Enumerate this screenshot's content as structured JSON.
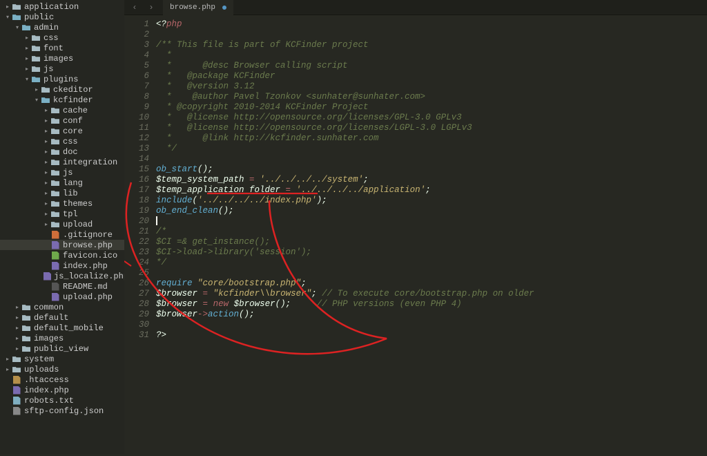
{
  "tab": {
    "name": "browse.php"
  },
  "nav": {
    "back": "‹",
    "forward": "›"
  },
  "tree": [
    {
      "indent": 0,
      "type": "folder-closed",
      "label": "application",
      "tri": "▸"
    },
    {
      "indent": 0,
      "type": "folder-open",
      "label": "public",
      "tri": "▾"
    },
    {
      "indent": 1,
      "type": "folder-open",
      "label": "admin",
      "tri": "▾"
    },
    {
      "indent": 2,
      "type": "folder-closed",
      "label": "css",
      "tri": "▸"
    },
    {
      "indent": 2,
      "type": "folder-closed",
      "label": "font",
      "tri": "▸"
    },
    {
      "indent": 2,
      "type": "folder-closed",
      "label": "images",
      "tri": "▸"
    },
    {
      "indent": 2,
      "type": "folder-closed",
      "label": "js",
      "tri": "▸"
    },
    {
      "indent": 2,
      "type": "folder-open",
      "label": "plugins",
      "tri": "▾"
    },
    {
      "indent": 3,
      "type": "folder-closed",
      "label": "ckeditor",
      "tri": "▸"
    },
    {
      "indent": 3,
      "type": "folder-open",
      "label": "kcfinder",
      "tri": "▾"
    },
    {
      "indent": 4,
      "type": "folder-closed",
      "label": "cache",
      "tri": "▸"
    },
    {
      "indent": 4,
      "type": "folder-closed",
      "label": "conf",
      "tri": "▸"
    },
    {
      "indent": 4,
      "type": "folder-closed",
      "label": "core",
      "tri": "▸"
    },
    {
      "indent": 4,
      "type": "folder-closed",
      "label": "css",
      "tri": "▸"
    },
    {
      "indent": 4,
      "type": "folder-closed",
      "label": "doc",
      "tri": "▸"
    },
    {
      "indent": 4,
      "type": "folder-closed",
      "label": "integration",
      "tri": "▸"
    },
    {
      "indent": 4,
      "type": "folder-closed",
      "label": "js",
      "tri": "▸"
    },
    {
      "indent": 4,
      "type": "folder-closed",
      "label": "lang",
      "tri": "▸"
    },
    {
      "indent": 4,
      "type": "folder-closed",
      "label": "lib",
      "tri": "▸"
    },
    {
      "indent": 4,
      "type": "folder-closed",
      "label": "themes",
      "tri": "▸"
    },
    {
      "indent": 4,
      "type": "folder-closed",
      "label": "tpl",
      "tri": "▸"
    },
    {
      "indent": 4,
      "type": "folder-closed",
      "label": "upload",
      "tri": "▸"
    },
    {
      "indent": 4,
      "type": "file-git",
      "label": ".gitignore"
    },
    {
      "indent": 4,
      "type": "file-php",
      "label": "browse.php",
      "selected": true
    },
    {
      "indent": 4,
      "type": "file-img",
      "label": "favicon.ico"
    },
    {
      "indent": 4,
      "type": "file-php",
      "label": "index.php"
    },
    {
      "indent": 4,
      "type": "file-php",
      "label": "js_localize.php"
    },
    {
      "indent": 4,
      "type": "file-md",
      "label": "README.md"
    },
    {
      "indent": 4,
      "type": "file-php",
      "label": "upload.php"
    },
    {
      "indent": 1,
      "type": "folder-closed",
      "label": "common",
      "tri": "▸"
    },
    {
      "indent": 1,
      "type": "folder-closed",
      "label": "default",
      "tri": "▸"
    },
    {
      "indent": 1,
      "type": "folder-closed",
      "label": "default_mobile",
      "tri": "▸"
    },
    {
      "indent": 1,
      "type": "folder-closed",
      "label": "images",
      "tri": "▸"
    },
    {
      "indent": 1,
      "type": "folder-closed",
      "label": "public_view",
      "tri": "▸"
    },
    {
      "indent": 0,
      "type": "folder-closed",
      "label": "system",
      "tri": "▸"
    },
    {
      "indent": 0,
      "type": "folder-closed",
      "label": "uploads",
      "tri": "▸"
    },
    {
      "indent": 0,
      "type": "file-cfg",
      "label": ".htaccess"
    },
    {
      "indent": 0,
      "type": "file-php",
      "label": "index.php"
    },
    {
      "indent": 0,
      "type": "file-txt",
      "label": "robots.txt"
    },
    {
      "indent": 0,
      "type": "file-json",
      "label": "sftp-config.json"
    }
  ],
  "code": {
    "lines": [
      {
        "n": 1,
        "html": "<span class='c-pun'>&lt;?</span><span class='c-kw'>php</span>"
      },
      {
        "n": 2,
        "html": ""
      },
      {
        "n": 3,
        "html": "<span class='c-com'>/** This file is part of KCFinder project</span>"
      },
      {
        "n": 4,
        "html": "<span class='c-com'>  *</span>"
      },
      {
        "n": 5,
        "html": "<span class='c-com'>  *      @desc Browser calling script</span>"
      },
      {
        "n": 6,
        "html": "<span class='c-com'>  *   @package KCFinder</span>"
      },
      {
        "n": 7,
        "html": "<span class='c-com'>  *   @version 3.12</span>"
      },
      {
        "n": 8,
        "html": "<span class='c-com'>  *    @author Pavel Tzonkov &lt;sunhater@sunhater.com&gt;</span>"
      },
      {
        "n": 9,
        "html": "<span class='c-com'>  * @copyright 2010-2014 KCFinder Project</span>"
      },
      {
        "n": 10,
        "html": "<span class='c-com'>  *   @license http://opensource.org/licenses/GPL-3.0 GPLv3</span>"
      },
      {
        "n": 11,
        "html": "<span class='c-com'>  *   @license http://opensource.org/licenses/LGPL-3.0 LGPLv3</span>"
      },
      {
        "n": 12,
        "html": "<span class='c-com'>  *      @link http://kcfinder.sunhater.com</span>"
      },
      {
        "n": 13,
        "html": "<span class='c-com'>  */</span>"
      },
      {
        "n": 14,
        "html": ""
      },
      {
        "n": 15,
        "html": "<span class='c-fn'>ob_start</span><span class='c-pun'>();</span>"
      },
      {
        "n": 16,
        "html": "<span class='c-var'>$temp_system_path</span> <span class='c-kw'>=</span> <span class='c-str'>'../../../../system'</span><span class='c-pun'>;</span>"
      },
      {
        "n": 17,
        "html": "<span class='c-var'>$temp_application_folder</span> <span class='c-kw'>=</span> <span class='c-str'>'../../../../application'</span><span class='c-pun'>;</span>"
      },
      {
        "n": 18,
        "html": "<span class='c-kw2'>include</span><span class='c-pun'>(</span><span class='c-str'>'../../../../index.php'</span><span class='c-pun'>);</span>"
      },
      {
        "n": 19,
        "html": "<span class='c-fn'>ob_end_clean</span><span class='c-pun'>();</span>"
      },
      {
        "n": 20,
        "html": "<span class='cursor'></span>"
      },
      {
        "n": 21,
        "html": "<span class='c-com'>/*</span>"
      },
      {
        "n": 22,
        "html": "<span class='c-com'>$CI =&amp; get_instance();</span>"
      },
      {
        "n": 23,
        "html": "<span class='c-com'>$CI-&gt;load-&gt;library('session');</span>"
      },
      {
        "n": 24,
        "html": "<span class='c-com'>*/</span>"
      },
      {
        "n": 25,
        "html": ""
      },
      {
        "n": 26,
        "html": "<span class='c-kw2'>require</span> <span class='c-str'>\"core/bootstrap.php\"</span><span class='c-pun'>;</span>"
      },
      {
        "n": 27,
        "html": "<span class='c-var'>$browser</span> <span class='c-kw'>=</span> <span class='c-str'>\"kcfinder\\\\browser\"</span><span class='c-pun'>;</span> <span class='c-com'>// To execute core/bootstrap.php on older</span>"
      },
      {
        "n": 28,
        "html": "<span class='c-var'>$browser</span> <span class='c-kw'>=</span> <span class='c-kw'>new</span> <span class='c-var'>$browser</span><span class='c-pun'>();</span>     <span class='c-com'>// PHP versions (even PHP 4)</span>"
      },
      {
        "n": 29,
        "html": "<span class='c-var'>$browser</span><span class='c-kw'>-&gt;</span><span class='c-fn'>action</span><span class='c-pun'>();</span>"
      },
      {
        "n": 30,
        "html": ""
      },
      {
        "n": 31,
        "html": "<span class='c-pun'>?&gt;</span>"
      }
    ]
  }
}
